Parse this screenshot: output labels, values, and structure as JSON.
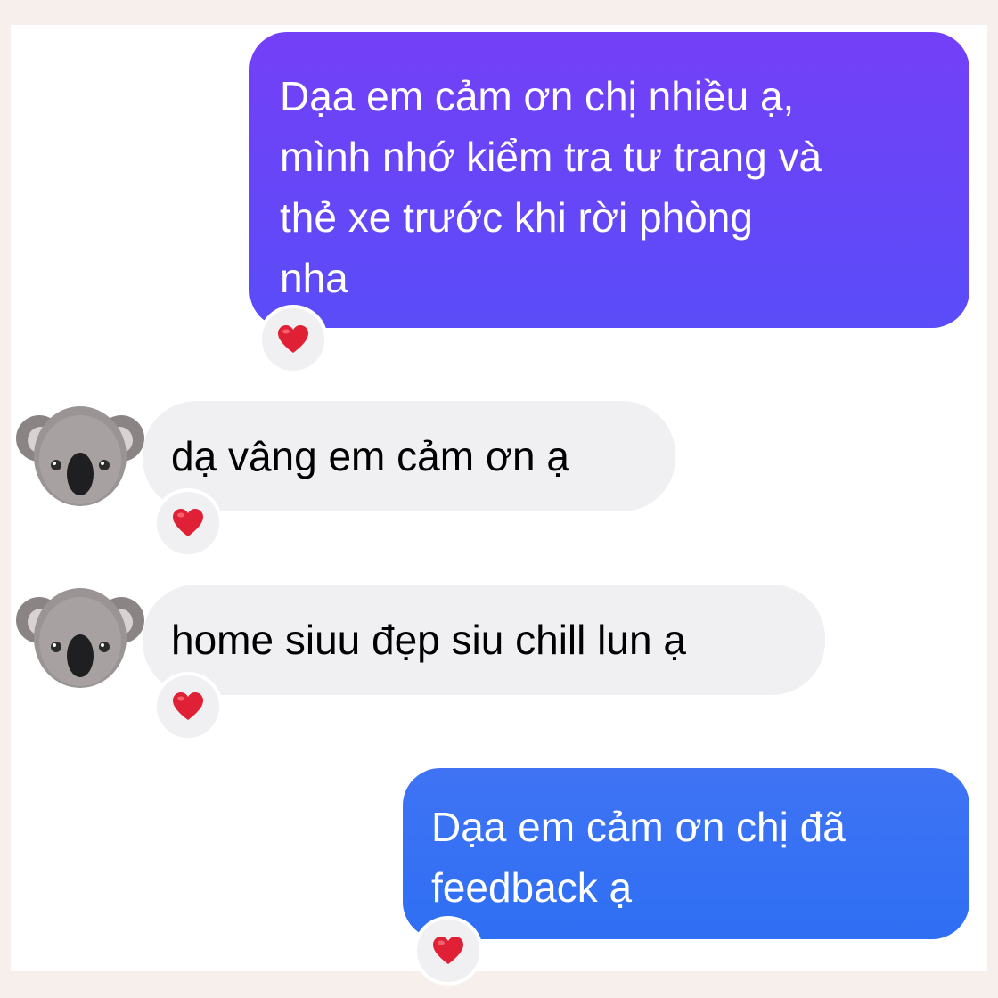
{
  "conversation": {
    "messages": [
      {
        "sender": "me",
        "text": "Dạa em cảm ơn chị nhiều ạ,\nmình nhớ kiểm tra tư trang và\nthẻ xe trước khi rời phòng\nnha",
        "reaction": "heart-icon"
      },
      {
        "sender": "other",
        "avatar": "koala-icon",
        "text": "dạ vâng em cảm ơn ạ",
        "reaction": "heart-icon"
      },
      {
        "sender": "other",
        "avatar": "koala-icon",
        "text": "home siuu đẹp siu chill lun ạ",
        "reaction": "heart-icon"
      },
      {
        "sender": "me",
        "text": "Dạa em cảm ơn chị đã\nfeedback ạ",
        "reaction": "heart-icon"
      }
    ]
  },
  "colors": {
    "outgoing_bubble_1": "#5f48f8",
    "outgoing_bubble_2": "#3370f4",
    "incoming_bubble": "#f0f0f3",
    "heart": "#e02035",
    "background": "#f6efec"
  }
}
